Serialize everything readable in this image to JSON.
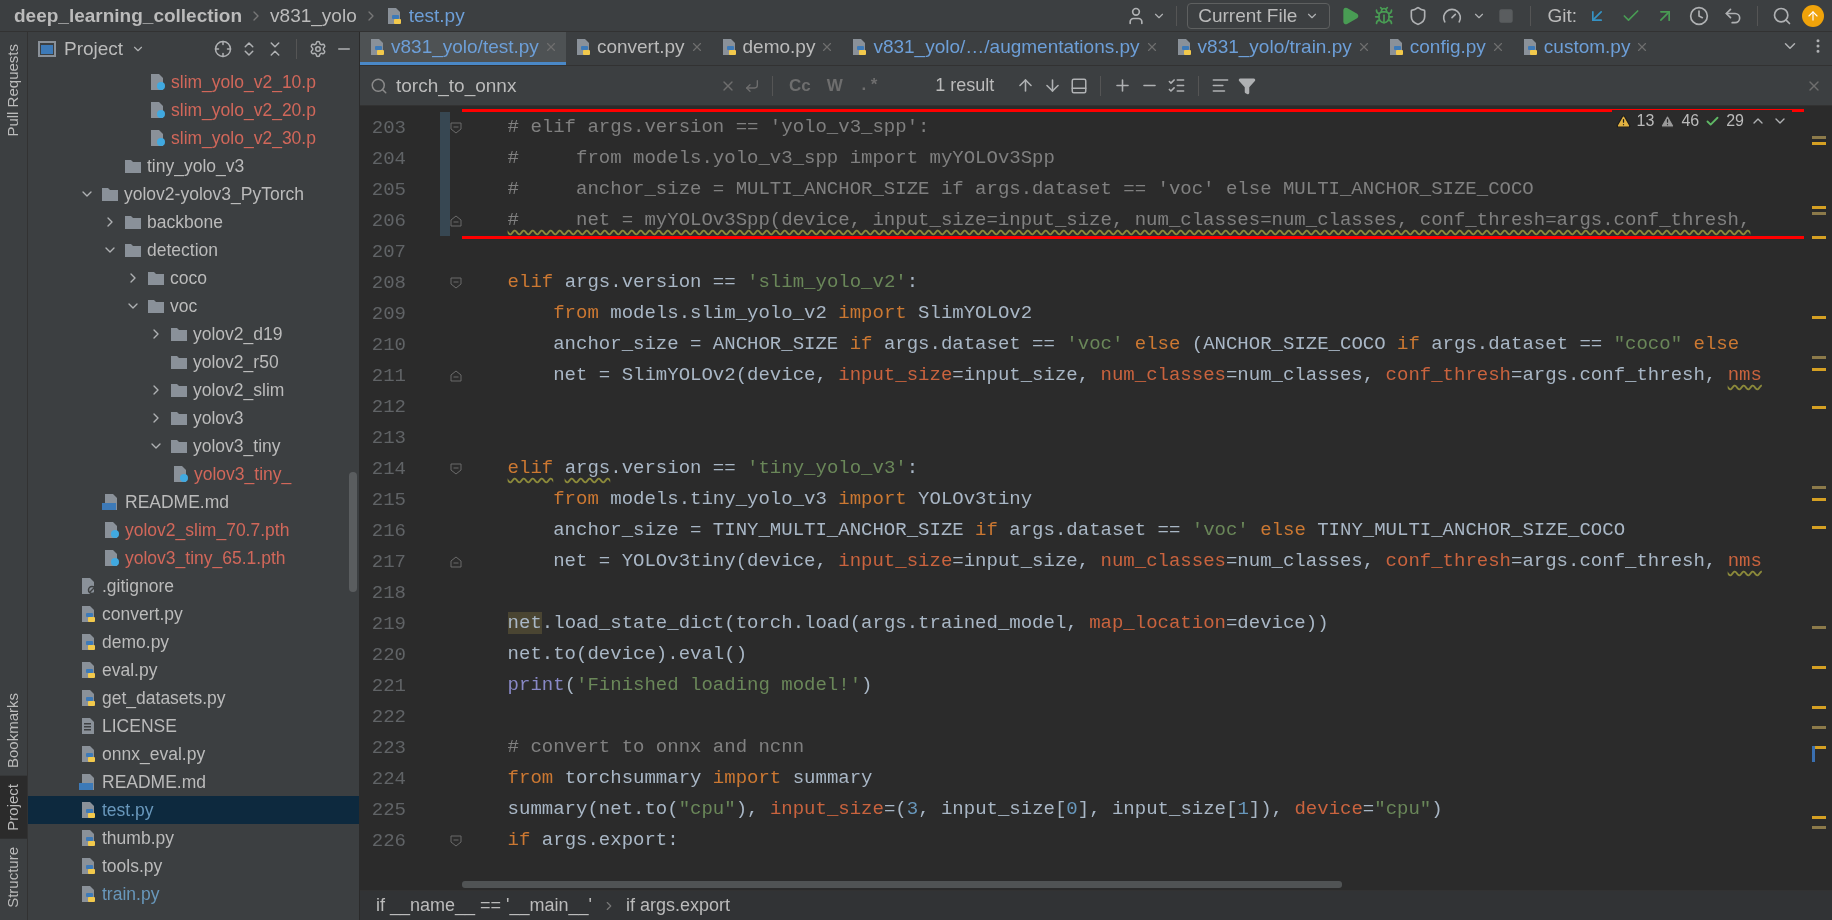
{
  "title_bar": {
    "breadcrumbs": [
      {
        "text": "deep_learning_collection",
        "kind": "project"
      },
      {
        "text": "v831_yolo",
        "kind": "folder"
      },
      {
        "text": "test.py",
        "kind": "file"
      }
    ],
    "run_config": "Current File",
    "vcs_label": "Git:"
  },
  "tool_strip": {
    "top": [
      {
        "label": "Pull Requests",
        "selected": false
      }
    ],
    "bottom": [
      {
        "label": "Bookmarks",
        "selected": false
      },
      {
        "label": "Project",
        "selected": true
      },
      {
        "label": "Structure",
        "selected": false
      }
    ]
  },
  "project_panel": {
    "title": "Project",
    "tree": [
      {
        "children": [
          {
            "children": [
              {
                "children": [
                  {
                    "label": "slim_yolo_v2_10.p",
                    "kind": "unknown",
                    "untracked": true,
                    "modified": false,
                    "selected": false
                  },
                  {
                    "label": "slim_yolo_v2_20.p",
                    "kind": "unknown",
                    "untracked": true,
                    "modified": false,
                    "selected": false
                  },
                  {
                    "label": "slim_yolo_v2_30.p",
                    "kind": "unknown",
                    "untracked": true,
                    "modified": false,
                    "selected": false
                  }
                ]
              }
            ]
          },
          {
            "label": "tiny_yolo_v3",
            "kind": "folder",
            "untracked": false,
            "modified": false,
            "selected": false
          }
        ]
      },
      {
        "label": "yolov2-yolov3_PyTorch",
        "kind": "folder",
        "expanded": true,
        "untracked": false,
        "modified": false,
        "selected": false,
        "children": [
          {
            "label": "backbone",
            "kind": "folder",
            "expanded": false,
            "untracked": false,
            "modified": false,
            "selected": false
          },
          {
            "label": "detection",
            "kind": "folder",
            "expanded": true,
            "untracked": false,
            "modified": false,
            "selected": false,
            "children": [
              {
                "label": "coco",
                "kind": "folder",
                "expanded": false,
                "untracked": false,
                "modified": false,
                "selected": false
              },
              {
                "label": "voc",
                "kind": "folder",
                "expanded": true,
                "untracked": false,
                "modified": false,
                "selected": false,
                "children": [
                  {
                    "label": "yolov2_d19",
                    "kind": "folder",
                    "expanded": false,
                    "untracked": false,
                    "modified": false,
                    "selected": false
                  },
                  {
                    "label": "yolov2_r50",
                    "kind": "folder",
                    "untracked": false,
                    "modified": false,
                    "selected": false
                  },
                  {
                    "label": "yolov2_slim",
                    "kind": "folder",
                    "expanded": false,
                    "untracked": false,
                    "modified": false,
                    "selected": false
                  },
                  {
                    "label": "yolov3",
                    "kind": "folder",
                    "expanded": false,
                    "untracked": false,
                    "modified": false,
                    "selected": false
                  },
                  {
                    "label": "yolov3_tiny",
                    "kind": "folder",
                    "expanded": true,
                    "untracked": false,
                    "modified": false,
                    "selected": false,
                    "children": [
                      {
                        "label": "yolov3_tiny_",
                        "kind": "unknown",
                        "untracked": true,
                        "modified": false,
                        "selected": false
                      }
                    ]
                  }
                ]
              }
            ]
          },
          {
            "label": "README.md",
            "kind": "markdown",
            "untracked": false,
            "modified": false,
            "selected": false
          },
          {
            "label": "yolov2_slim_70.7.pth",
            "kind": "unknown",
            "untracked": true,
            "modified": false,
            "selected": false
          },
          {
            "label": "yolov3_tiny_65.1.pth",
            "kind": "unknown",
            "untracked": true,
            "modified": false,
            "selected": false
          }
        ]
      },
      {
        "label": ".gitignore",
        "kind": "ignore",
        "untracked": false,
        "modified": false,
        "selected": false
      },
      {
        "label": "convert.py",
        "kind": "python",
        "untracked": false,
        "modified": false,
        "selected": false
      },
      {
        "label": "demo.py",
        "kind": "python",
        "untracked": false,
        "modified": false,
        "selected": false
      },
      {
        "label": "eval.py",
        "kind": "python",
        "untracked": false,
        "modified": false,
        "selected": false
      },
      {
        "label": "get_datasets.py",
        "kind": "python",
        "untracked": false,
        "modified": false,
        "selected": false
      },
      {
        "label": "LICENSE",
        "kind": "text",
        "untracked": false,
        "modified": false,
        "selected": false
      },
      {
        "label": "onnx_eval.py",
        "kind": "python",
        "untracked": false,
        "modified": false,
        "selected": false
      },
      {
        "label": "README.md",
        "kind": "markdown",
        "untracked": false,
        "modified": false,
        "selected": false
      },
      {
        "label": "test.py",
        "kind": "python",
        "untracked": false,
        "modified": true,
        "selected": true
      },
      {
        "label": "thumb.py",
        "kind": "python",
        "untracked": false,
        "modified": false,
        "selected": false
      },
      {
        "label": "tools.py",
        "kind": "python",
        "untracked": false,
        "modified": false,
        "selected": false
      },
      {
        "label": "train.py",
        "kind": "python",
        "untracked": false,
        "modified": true,
        "selected": false
      }
    ]
  },
  "tabs": [
    {
      "label": "v831_yolo/test.py",
      "modified": true,
      "selected": true
    },
    {
      "label": "convert.py",
      "modified": false,
      "selected": false
    },
    {
      "label": "demo.py",
      "modified": false,
      "selected": false
    },
    {
      "label": "v831_yolo/…/augmentations.py",
      "modified": true,
      "selected": false
    },
    {
      "label": "v831_yolo/train.py",
      "modified": true,
      "selected": false
    },
    {
      "label": "config.py",
      "modified": true,
      "selected": false
    },
    {
      "label": "custom.py",
      "modified": true,
      "selected": false
    }
  ],
  "search": {
    "value": "torch_to_onnx",
    "options": [
      {
        "label": "Cc",
        "kind": "case"
      },
      {
        "label": "W",
        "kind": "words"
      },
      {
        "label": ".*",
        "kind": "regex"
      }
    ],
    "result": "1 result"
  },
  "inspections": [
    {
      "kind": "warning",
      "count": "13"
    },
    {
      "kind": "weak",
      "count": "46"
    },
    {
      "kind": "typo",
      "count": "29"
    }
  ],
  "editor": {
    "lines": [
      {
        "number": "203",
        "boxed": true,
        "changed": true,
        "fold_start": true,
        "fold_end": false,
        "tokens": [
          {
            "kind": "comment",
            "text": "    # elif args.version == 'yolo_v3_spp':"
          }
        ]
      },
      {
        "number": "204",
        "boxed": true,
        "changed": true,
        "fold_start": false,
        "fold_end": false,
        "tokens": [
          {
            "kind": "comment",
            "text": "    #     from models.yolo_v3_spp import myYOLOv3Spp"
          }
        ]
      },
      {
        "number": "205",
        "boxed": true,
        "changed": true,
        "fold_start": false,
        "fold_end": false,
        "tokens": [
          {
            "kind": "comment",
            "text": "    #     anchor_size = MULTI_ANCHOR_SIZE if args.dataset == 'voc' else MULTI_ANCHOR_SIZE_COCO"
          }
        ]
      },
      {
        "number": "206",
        "boxed": true,
        "changed": true,
        "fold_start": false,
        "fold_end": true,
        "tokens": [
          {
            "kind": "comment",
            "text": "    #     net = myYOLOv3Spp(device, input_size=input_size, num_classes=num_classes, conf_thresh=args.conf_thresh,",
            "warning": true
          }
        ]
      },
      {
        "number": "207",
        "boxed": false,
        "changed": false,
        "fold_start": false,
        "fold_end": false
      },
      {
        "number": "208",
        "boxed": false,
        "changed": false,
        "fold_start": true,
        "fold_end": false,
        "tokens": [
          {
            "kind": "kw",
            "text": "    elif"
          },
          {
            "kind": "plain",
            "text": " args.version == "
          },
          {
            "kind": "str",
            "text": "'slim_yolo_v2'"
          },
          {
            "kind": "plain",
            "text": ":"
          }
        ]
      },
      {
        "number": "209",
        "boxed": false,
        "changed": false,
        "fold_start": false,
        "fold_end": false,
        "tokens": [
          {
            "kind": "kw",
            "text": "        from"
          },
          {
            "kind": "plain",
            "text": " models.slim_yolo_v2 "
          },
          {
            "kind": "kw",
            "text": "import"
          },
          {
            "kind": "plain",
            "text": " SlimYOLOv2"
          }
        ]
      },
      {
        "number": "210",
        "boxed": false,
        "changed": false,
        "fold_start": false,
        "fold_end": false,
        "tokens": [
          {
            "kind": "plain",
            "text": "        anchor_size = ANCHOR_SIZE "
          },
          {
            "kind": "kw",
            "text": "if"
          },
          {
            "kind": "plain",
            "text": " args.dataset == "
          },
          {
            "kind": "str",
            "text": "'voc'"
          },
          {
            "kind": "kw",
            "text": " else"
          },
          {
            "kind": "plain",
            "text": " (ANCHOR_SIZE_COCO "
          },
          {
            "kind": "kw",
            "text": "if"
          },
          {
            "kind": "plain",
            "text": " args.dataset == "
          },
          {
            "kind": "str",
            "text": "\"coco\""
          },
          {
            "kind": "kw",
            "text": " else"
          }
        ]
      },
      {
        "number": "211",
        "boxed": false,
        "changed": false,
        "fold_start": false,
        "fold_end": true,
        "tokens": [
          {
            "kind": "plain",
            "text": "        net = SlimYOLOv2(device, "
          },
          {
            "kind": "param",
            "text": "input_size"
          },
          {
            "kind": "plain",
            "text": "=input_size, "
          },
          {
            "kind": "param",
            "text": "num_classes"
          },
          {
            "kind": "plain",
            "text": "=num_classes, "
          },
          {
            "kind": "param",
            "text": "conf_thresh"
          },
          {
            "kind": "plain",
            "text": "=args.conf_thresh, "
          },
          {
            "kind": "param",
            "text": "nms",
            "warning": true
          }
        ]
      },
      {
        "number": "212",
        "boxed": false,
        "changed": false,
        "fold_start": false,
        "fold_end": false
      },
      {
        "number": "213",
        "boxed": false,
        "changed": false,
        "fold_start": false,
        "fold_end": false
      },
      {
        "number": "214",
        "boxed": false,
        "changed": false,
        "fold_start": true,
        "fold_end": false,
        "tokens": [
          {
            "kind": "kw",
            "text": "    elif",
            "warning": true
          },
          {
            "kind": "plain",
            "text": " args",
            "warning": true
          },
          {
            "kind": "plain",
            "text": ".version == "
          },
          {
            "kind": "str",
            "text": "'tiny_yolo_v3'"
          },
          {
            "kind": "plain",
            "text": ":"
          }
        ]
      },
      {
        "number": "215",
        "boxed": false,
        "changed": false,
        "fold_start": false,
        "fold_end": false,
        "tokens": [
          {
            "kind": "kw",
            "text": "        from"
          },
          {
            "kind": "plain",
            "text": " models.tiny_yolo_v3 "
          },
          {
            "kind": "kw",
            "text": "import"
          },
          {
            "kind": "plain",
            "text": " YOLOv3tiny"
          }
        ]
      },
      {
        "number": "216",
        "boxed": false,
        "changed": false,
        "fold_start": false,
        "fold_end": false,
        "tokens": [
          {
            "kind": "plain",
            "text": "        anchor_size = TINY_MULTI_ANCHOR_SIZE "
          },
          {
            "kind": "kw",
            "text": "if"
          },
          {
            "kind": "plain",
            "text": " args.dataset == "
          },
          {
            "kind": "str",
            "text": "'voc'"
          },
          {
            "kind": "kw",
            "text": " else"
          },
          {
            "kind": "plain",
            "text": " TINY_MULTI_ANCHOR_SIZE_COCO"
          }
        ]
      },
      {
        "number": "217",
        "boxed": false,
        "changed": false,
        "fold_start": false,
        "fold_end": true,
        "tokens": [
          {
            "kind": "plain",
            "text": "        net = YOLOv3tiny(device, "
          },
          {
            "kind": "param",
            "text": "input_size"
          },
          {
            "kind": "plain",
            "text": "=input_size, "
          },
          {
            "kind": "param",
            "text": "num_classes"
          },
          {
            "kind": "plain",
            "text": "=num_classes, "
          },
          {
            "kind": "param",
            "text": "conf_thresh"
          },
          {
            "kind": "plain",
            "text": "=args.conf_thresh, "
          },
          {
            "kind": "param",
            "text": "nms",
            "warning": true
          }
        ]
      },
      {
        "number": "218",
        "boxed": false,
        "changed": false,
        "fold_start": false,
        "fold_end": false
      },
      {
        "number": "219",
        "boxed": false,
        "changed": false,
        "fold_start": false,
        "fold_end": false,
        "tokens": [
          {
            "kind": "usage",
            "text": "    net"
          },
          {
            "kind": "plain",
            "text": ".load_state_dict(torch.load(args.trained_model, "
          },
          {
            "kind": "param",
            "text": "map_location"
          },
          {
            "kind": "plain",
            "text": "=device))"
          }
        ]
      },
      {
        "number": "220",
        "boxed": false,
        "changed": false,
        "fold_start": false,
        "fold_end": false,
        "tokens": [
          {
            "kind": "plain",
            "text": "    net.to(device).eval()"
          }
        ]
      },
      {
        "number": "221",
        "boxed": false,
        "changed": false,
        "fold_start": false,
        "fold_end": false,
        "tokens": [
          {
            "kind": "builtin",
            "text": "    print"
          },
          {
            "kind": "plain",
            "text": "("
          },
          {
            "kind": "str",
            "text": "'Finished loading model!'"
          },
          {
            "kind": "plain",
            "text": ")"
          }
        ]
      },
      {
        "number": "222",
        "boxed": false,
        "changed": false,
        "fold_start": false,
        "fold_end": false
      },
      {
        "number": "223",
        "boxed": false,
        "changed": false,
        "fold_start": false,
        "fold_end": false,
        "tokens": [
          {
            "kind": "comment",
            "text": "    # convert to onnx and ncnn"
          }
        ]
      },
      {
        "number": "224",
        "boxed": false,
        "changed": false,
        "fold_start": false,
        "fold_end": false,
        "tokens": [
          {
            "kind": "kw",
            "text": "    from"
          },
          {
            "kind": "plain",
            "text": " torchsummary "
          },
          {
            "kind": "kw",
            "text": "import"
          },
          {
            "kind": "plain",
            "text": " summary"
          }
        ]
      },
      {
        "number": "225",
        "boxed": false,
        "changed": false,
        "fold_start": false,
        "fold_end": false,
        "tokens": [
          {
            "kind": "plain",
            "text": "    summary(net.to("
          },
          {
            "kind": "str",
            "text": "\"cpu\""
          },
          {
            "kind": "plain",
            "text": "), "
          },
          {
            "kind": "param",
            "text": "input_size"
          },
          {
            "kind": "plain",
            "text": "=("
          },
          {
            "kind": "num",
            "text": "3"
          },
          {
            "kind": "plain",
            "text": ", input_size["
          },
          {
            "kind": "num",
            "text": "0"
          },
          {
            "kind": "plain",
            "text": "], input_size["
          },
          {
            "kind": "num",
            "text": "1"
          },
          {
            "kind": "plain",
            "text": "]), "
          },
          {
            "kind": "param",
            "text": "device"
          },
          {
            "kind": "plain",
            "text": "="
          },
          {
            "kind": "str",
            "text": "\"cpu\""
          },
          {
            "kind": "plain",
            "text": ")"
          }
        ]
      },
      {
        "number": "226",
        "boxed": false,
        "changed": false,
        "fold_start": true,
        "fold_end": false,
        "tokens": [
          {
            "kind": "kw",
            "text": "    if"
          },
          {
            "kind": "plain",
            "text": " args.export:"
          }
        ]
      }
    ]
  },
  "breadcrumbs": [
    "if __name__ == '__main__'",
    "if args.export"
  ]
}
